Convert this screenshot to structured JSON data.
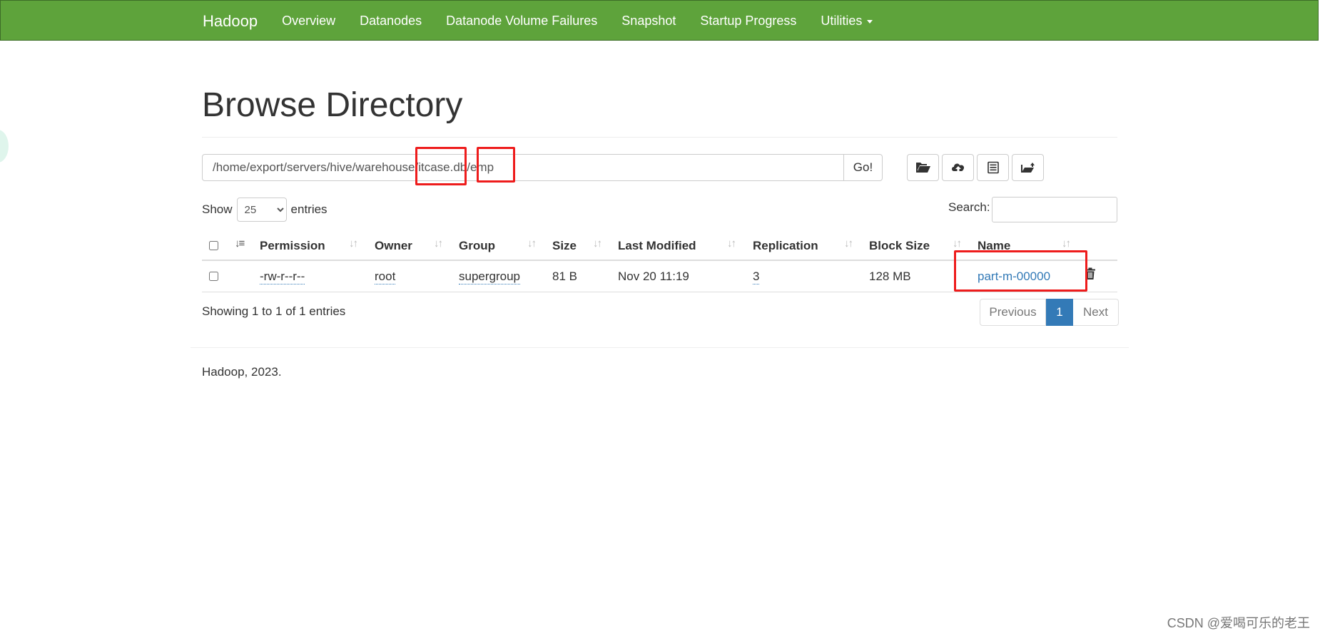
{
  "navbar": {
    "brand": "Hadoop",
    "items": [
      {
        "label": "Overview"
      },
      {
        "label": "Datanodes"
      },
      {
        "label": "Datanode Volume Failures"
      },
      {
        "label": "Snapshot"
      },
      {
        "label": "Startup Progress"
      },
      {
        "label": "Utilities"
      }
    ],
    "color": "#5ea33b"
  },
  "page": {
    "title": "Browse Directory"
  },
  "path": {
    "value": "/home/export/servers/hive/warehouse/itcase.db/emp",
    "go_label": "Go!"
  },
  "toolbar": {
    "icons": [
      "folder-open-icon",
      "cloud-upload-icon",
      "list-alt-icon",
      "folder-move-icon"
    ]
  },
  "table_controls": {
    "show_label": "Show",
    "page_size": "25",
    "entries_label": "entries",
    "search_label": "Search:",
    "search_value": ""
  },
  "table": {
    "columns": [
      "Permission",
      "Owner",
      "Group",
      "Size",
      "Last Modified",
      "Replication",
      "Block Size",
      "Name"
    ],
    "rows": [
      {
        "permission": "-rw-r--r--",
        "owner": "root",
        "group": "supergroup",
        "size": "81 B",
        "last_modified": "Nov 20 11:19",
        "replication": "3",
        "block_size": "128 MB",
        "name": "part-m-00000"
      }
    ]
  },
  "pagination": {
    "info": "Showing 1 to 1 of 1 entries",
    "previous": "Previous",
    "current_page": "1",
    "next": "Next",
    "active_color": "#337ab7"
  },
  "footer": {
    "text": "Hadoop, 2023."
  },
  "annotations": {
    "highlight_color": "#ee1c1c"
  },
  "watermark": {
    "text": "CSDN @爱喝可乐的老王"
  }
}
